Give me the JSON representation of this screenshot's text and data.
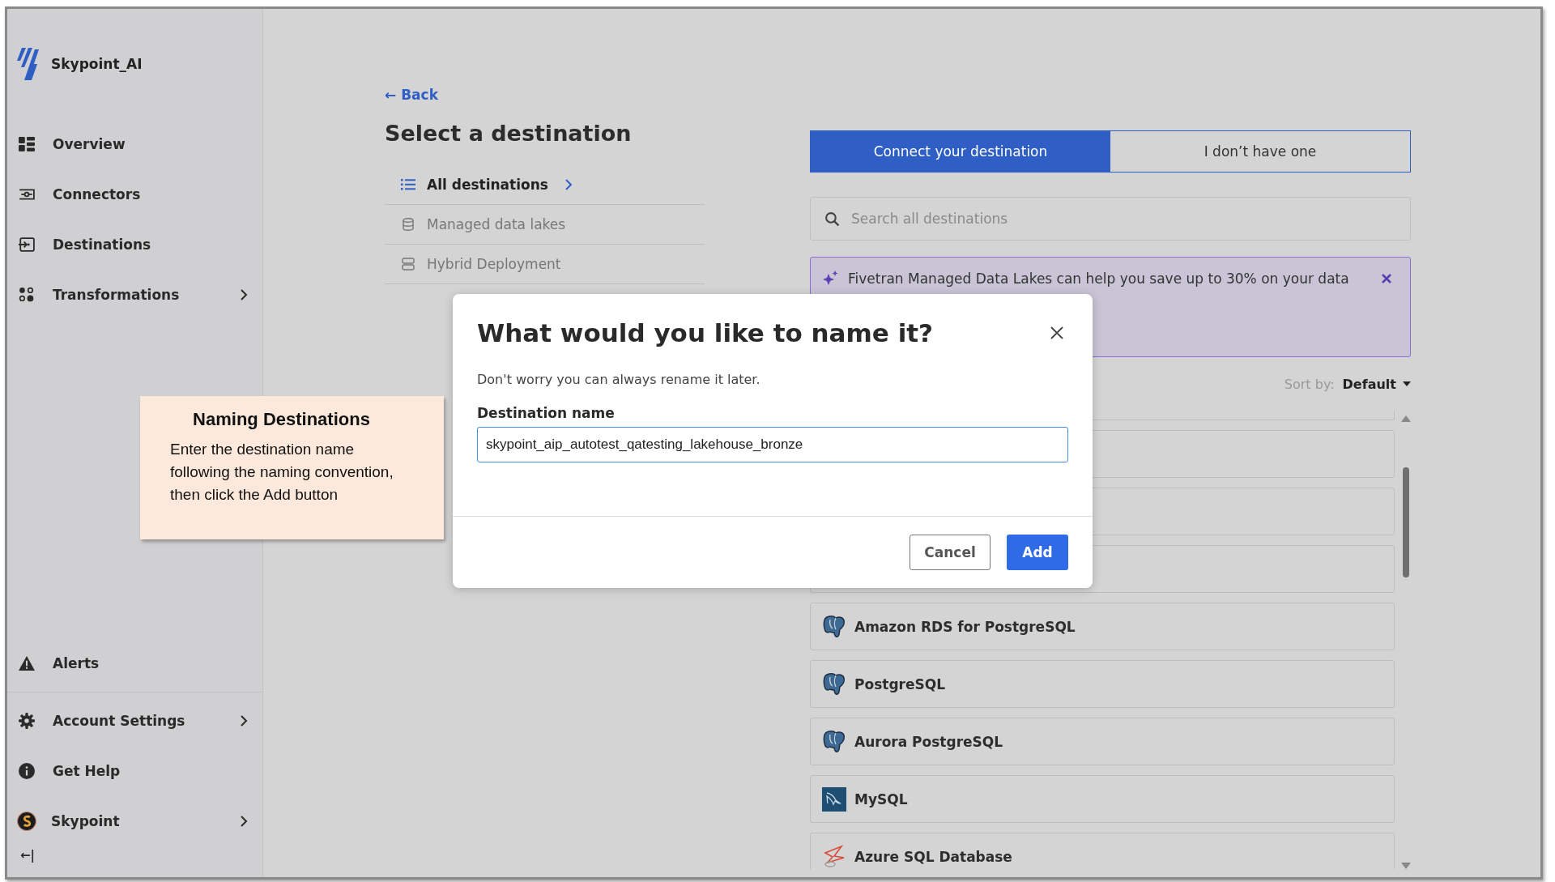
{
  "sidebar": {
    "brand": "Skypoint_AI",
    "items": [
      {
        "label": "Overview",
        "expandable": false
      },
      {
        "label": "Connectors",
        "expandable": false
      },
      {
        "label": "Destinations",
        "expandable": false
      },
      {
        "label": "Transformations",
        "expandable": true
      }
    ],
    "bottom_items": [
      {
        "label": "Alerts",
        "expandable": false
      },
      {
        "label": "Account Settings",
        "expandable": true
      },
      {
        "label": "Get Help",
        "expandable": false
      },
      {
        "label": "Skypoint",
        "expandable": true
      }
    ],
    "collapse_icon": "←|"
  },
  "back_link": "← Back",
  "page_title": "Select a destination",
  "categories": [
    {
      "label": "All destinations",
      "selected": true
    },
    {
      "label": "Managed data lakes",
      "selected": false
    },
    {
      "label": "Hybrid Deployment",
      "selected": false
    }
  ],
  "tabs": [
    {
      "label": "Connect your destination",
      "selected": true
    },
    {
      "label": "I don’t have one",
      "selected": false
    }
  ],
  "search": {
    "placeholder": "Search all destinations"
  },
  "banner": {
    "text": "Fivetran Managed Data Lakes can help you save up to 30% on your data"
  },
  "sort": {
    "label": "Sort by:",
    "value": "Default"
  },
  "destinations": [
    {
      "name": "Amazon RDS for PostgreSQL",
      "kind": "postgres"
    },
    {
      "name": "PostgreSQL",
      "kind": "postgres"
    },
    {
      "name": "Aurora PostgreSQL",
      "kind": "postgres"
    },
    {
      "name": "MySQL",
      "kind": "mysql"
    },
    {
      "name": "Azure SQL Database",
      "kind": "azure"
    }
  ],
  "dialog": {
    "title": "What would you like to name it?",
    "subtitle": "Don't worry you can always rename it later.",
    "field_label": "Destination name",
    "field_value": "skypoint_aip_autotest_qatesting_lakehouse_bronze",
    "cancel": "Cancel",
    "add": "Add"
  },
  "callout": {
    "title": "Naming Destinations",
    "body": "Enter the destination name following the naming convention, then click the Add button"
  }
}
